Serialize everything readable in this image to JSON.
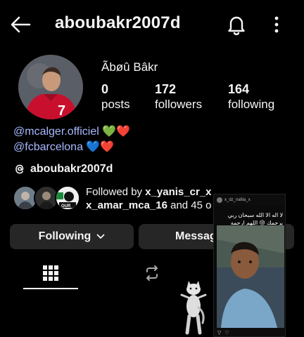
{
  "header": {
    "username": "aboubakr2007d",
    "back_icon": "back-arrow-icon",
    "bell_icon": "bell-icon",
    "more_icon": "more-vertical-icon"
  },
  "profile": {
    "display_name": "Ãbøû Bâkr",
    "stats": {
      "posts": {
        "value": "0",
        "label": "posts"
      },
      "followers": {
        "value": "172",
        "label": "followers"
      },
      "following": {
        "value": "164",
        "label": "following"
      }
    },
    "bio": [
      {
        "mention": "@mcalger.officiel",
        "emoji": "💚❤️"
      },
      {
        "mention": "@fcbarcelona",
        "emoji": "💙❤️"
      }
    ],
    "threads_handle": "aboubakr2007d",
    "followed_by": {
      "prefix": "Followed by ",
      "user1": "x_yanis_cr_x",
      "user2": "x_amar_mca_16",
      "suffix": " and 45 o"
    }
  },
  "actions": {
    "following_label": "Following",
    "message_label": "Messag"
  },
  "tabs": [
    {
      "name": "posts-grid",
      "icon": "grid-icon",
      "active": true
    },
    {
      "name": "reels",
      "icon": "repost-icon",
      "active": false
    }
  ],
  "video_overlay": {
    "top_text": "x_dz_nafiia_x",
    "caption": "لا اله الا الله سبحان ربي يرحمك 😢 اللهم ارحمه"
  },
  "colors": {
    "background": "#000000",
    "button_bg": "#262626",
    "mention": "#a8b9ff",
    "text": "#f5f5f5"
  }
}
